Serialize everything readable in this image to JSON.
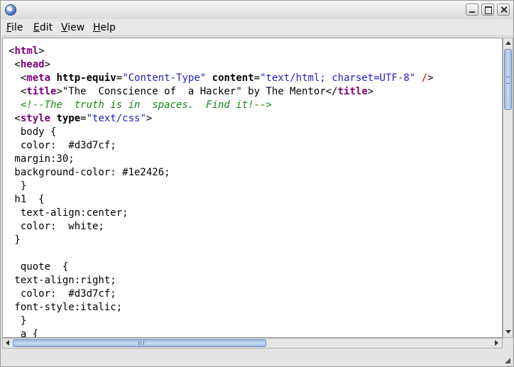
{
  "menu": {
    "file_mnemonic": "F",
    "file_rest": "ile",
    "edit_mnemonic": "E",
    "edit_rest": "dit",
    "view_mnemonic": "V",
    "view_rest": "iew",
    "help_mnemonic": "H",
    "help_rest": "elp"
  },
  "icons": {
    "app": "globe-icon",
    "minimize": "minimize-icon",
    "maximize": "maximize-icon",
    "close": "close-icon",
    "scroll_up": "arrow-up-icon",
    "scroll_down": "arrow-down-icon",
    "scroll_left": "arrow-left-icon",
    "scroll_right": "arrow-right-icon",
    "resize": "resize-grip-icon"
  },
  "colors": {
    "tag": "#7b007b",
    "attribute_value": "#1e1ec8",
    "comment": "#0f8a0f",
    "self_close_slash": "#d00000",
    "scroll_thumb": "#9ab8e0"
  },
  "code_lines": [
    [
      {
        "t": "<"
      },
      {
        "t": "html",
        "c": "tag"
      },
      {
        "t": ">"
      }
    ],
    [
      {
        "t": " <"
      },
      {
        "t": "head",
        "c": "tag"
      },
      {
        "t": ">"
      }
    ],
    [
      {
        "t": "  <"
      },
      {
        "t": "meta",
        "c": "tag"
      },
      {
        "t": " "
      },
      {
        "t": "http-equiv",
        "c": "attr"
      },
      {
        "t": "="
      },
      {
        "t": "\"Content-Type\"",
        "c": "val"
      },
      {
        "t": " "
      },
      {
        "t": "content",
        "c": "attr"
      },
      {
        "t": "="
      },
      {
        "t": "\"text/html; charset=UTF-8\"",
        "c": "val"
      },
      {
        "t": " "
      },
      {
        "t": "/",
        "c": "slash"
      },
      {
        "t": ">"
      }
    ],
    [
      {
        "t": "  <"
      },
      {
        "t": "title",
        "c": "tag"
      },
      {
        "t": ">\"The  Conscience of  a Hacker\" by The Mentor</"
      },
      {
        "t": "title",
        "c": "tag"
      },
      {
        "t": ">"
      }
    ],
    [
      {
        "t": "  "
      },
      {
        "t": "<!--The  truth is in  spaces.  Find it!-->",
        "c": "comment"
      }
    ],
    [
      {
        "t": " <"
      },
      {
        "t": "style",
        "c": "tag"
      },
      {
        "t": " "
      },
      {
        "t": "type",
        "c": "attr"
      },
      {
        "t": "="
      },
      {
        "t": "\"text/css\"",
        "c": "val"
      },
      {
        "t": ">"
      }
    ],
    [
      {
        "t": "  body {"
      }
    ],
    [
      {
        "t": "  color:  #d3d7cf;"
      }
    ],
    [
      {
        "t": " margin:30;"
      }
    ],
    [
      {
        "t": " background-color: #1e2426;"
      }
    ],
    [
      {
        "t": "  }"
      }
    ],
    [
      {
        "t": " h1  {"
      }
    ],
    [
      {
        "t": "  text-align:center;"
      }
    ],
    [
      {
        "t": "  color:  white;"
      }
    ],
    [
      {
        "t": " }"
      }
    ],
    [
      {
        "t": ""
      }
    ],
    [
      {
        "t": "  quote  {"
      }
    ],
    [
      {
        "t": " text-align:right;"
      }
    ],
    [
      {
        "t": "  color:  #d3d7cf;"
      }
    ],
    [
      {
        "t": " font-style:italic;"
      }
    ],
    [
      {
        "t": "  }"
      }
    ],
    [
      {
        "t": "  a {"
      }
    ]
  ],
  "scroll": {
    "vertical_position": 0.0,
    "vertical_visible_fraction": 0.22,
    "horizontal_position": 0.0,
    "horizontal_visible_fraction": 0.53
  }
}
